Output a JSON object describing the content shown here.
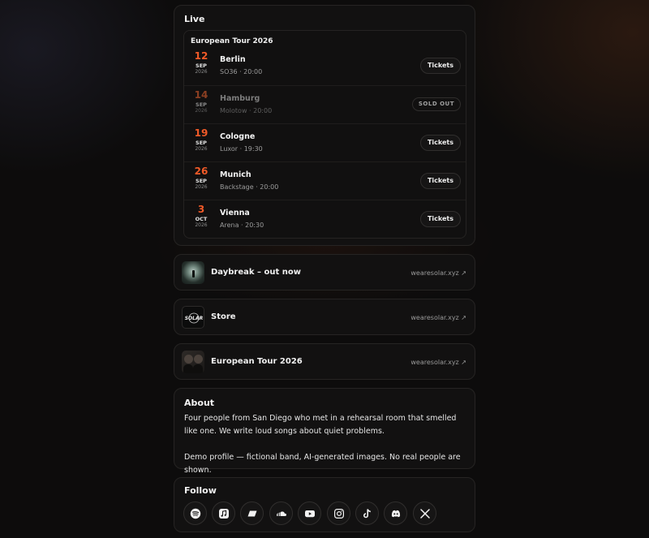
{
  "live": {
    "title": "Live",
    "tour_title": "European Tour 2026",
    "events": [
      {
        "day": "12",
        "month": "SEP",
        "year": "2026",
        "city": "Berlin",
        "venue": "SO36 · 20:00",
        "action": "Tickets",
        "status": "available"
      },
      {
        "day": "14",
        "month": "SEP",
        "year": "2026",
        "city": "Hamburg",
        "venue": "Molotow · 20:00",
        "action": "SOLD OUT",
        "status": "sold_out"
      },
      {
        "day": "19",
        "month": "SEP",
        "year": "2026",
        "city": "Cologne",
        "venue": "Luxor · 19:30",
        "action": "Tickets",
        "status": "available"
      },
      {
        "day": "26",
        "month": "SEP",
        "year": "2026",
        "city": "Munich",
        "venue": "Backstage · 20:00",
        "action": "Tickets",
        "status": "available"
      },
      {
        "day": "3",
        "month": "OCT",
        "year": "2026",
        "city": "Vienna",
        "venue": "Arena · 20:30",
        "action": "Tickets",
        "status": "available"
      }
    ]
  },
  "links": [
    {
      "label": "Daybreak – out now",
      "host": "wearesolar.xyz ↗"
    },
    {
      "label": "Store",
      "host": "wearesolar.xyz ↗",
      "logo_text": "SOLAR"
    },
    {
      "label": "European Tour 2026",
      "host": "wearesolar.xyz ↗"
    }
  ],
  "about": {
    "title": "About",
    "paragraph1": "Four people from San Diego who met in a rehearsal room that smelled like one. We write loud songs about quiet problems.",
    "paragraph2": "Demo profile — fictional band, AI-generated images. No real people are shown."
  },
  "follow": {
    "title": "Follow",
    "icons": [
      "spotify-icon",
      "apple-music-icon",
      "tidal-icon",
      "soundcloud-icon",
      "youtube-icon",
      "instagram-icon",
      "tiktok-icon",
      "discord-icon",
      "x-icon"
    ]
  },
  "colors": {
    "accent_date": "#f05a28",
    "background": "#0d0c0c",
    "card": "#121111",
    "border": "#262423"
  }
}
